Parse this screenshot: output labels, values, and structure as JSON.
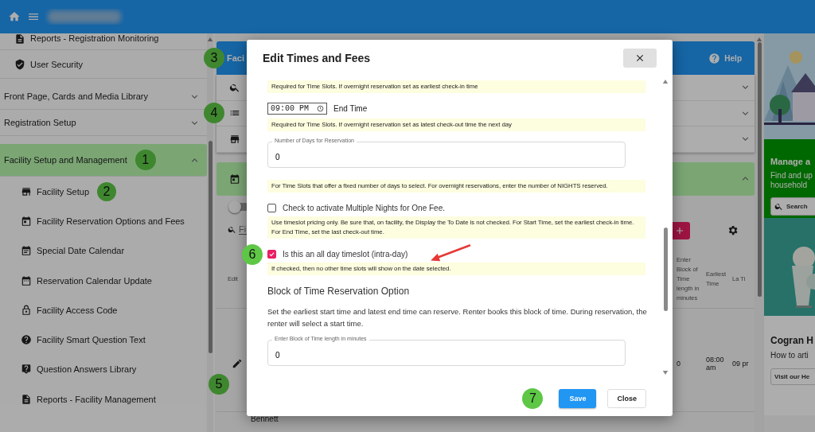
{
  "sidebar": {
    "items": [
      {
        "kind": "link",
        "label": "Reports - Registration Monitoring"
      },
      {
        "kind": "link",
        "label": "User Security"
      },
      {
        "kind": "section",
        "label": "Front Page, Cards and Media Library",
        "expanded": false
      },
      {
        "kind": "section",
        "label": "Registration Setup",
        "expanded": false
      },
      {
        "kind": "section",
        "label": "Facility Setup and Management",
        "expanded": true,
        "callout": "1",
        "children": [
          {
            "label": "Facility Setup",
            "callout": "2"
          },
          {
            "label": "Facility Reservation Options and Fees"
          },
          {
            "label": "Special Date Calendar"
          },
          {
            "label": "Reservation Calendar Update"
          },
          {
            "label": "Facility Access Code"
          },
          {
            "label": "Facility Smart Question Text"
          },
          {
            "label": "Question Answers Library"
          },
          {
            "label": "Reports - Facility Management"
          }
        ]
      }
    ]
  },
  "main": {
    "header": {
      "title": "Faci",
      "callout": "3",
      "help": "Help"
    },
    "rows": [
      {
        "expanded": false
      },
      {
        "expanded": false,
        "callout": "4"
      },
      {
        "expanded": false
      }
    ],
    "section": {
      "expanded": true
    },
    "toggle": {
      "on": false
    },
    "filter": {
      "placeholder": "Fi"
    },
    "table": {
      "columns": [
        "Edit",
        "Enter Block of Time length in minutes",
        "Earliest Time",
        "La Ti"
      ],
      "rows": [
        {
          "callout": "5",
          "cells": [
            "",
            "0",
            "08:00 am",
            "09 pr"
          ]
        }
      ],
      "next_row": "Bennett"
    }
  },
  "aside": {
    "cards": [
      {
        "title": "Manage a",
        "text": "Find and up household",
        "button": "Search"
      },
      {
        "title": "Cogran H",
        "text": "How to arti",
        "button": "Visit our He"
      }
    ]
  },
  "modal": {
    "title": "Edit Times and Fees",
    "body": [
      {
        "kind": "note",
        "text": "Required for Time Slots. If overnight reservation set as earliest check-in time"
      },
      {
        "kind": "time",
        "value": "09:00 PM",
        "label": "End Time"
      },
      {
        "kind": "note",
        "text": "Required for Time Slots. If overnight reservation set as latest check-out time the next day"
      },
      {
        "kind": "field",
        "label": "Number of Days for Reservation",
        "value": "0"
      },
      {
        "kind": "note",
        "text": "For Time Slots that offer a fixed number of days to select. For overnight reservations, enter the number of NIGHTS reserved."
      },
      {
        "kind": "checkbox",
        "label": "Check to activate Multiple Nights for One Fee.",
        "checked": false
      },
      {
        "kind": "note",
        "text": "Use timeslot pricing only. Be sure that, on facility, the Display the To Date is not checked. For Start Time, set the earliest check-in time. For End Time, set the last check-out time."
      },
      {
        "kind": "checkbox",
        "label": "Is this an all day timeslot (intra-day)",
        "checked": true,
        "callout": "6",
        "arrow": true
      },
      {
        "kind": "note",
        "text": "If checked, then no other time slots will show on the date selected."
      },
      {
        "kind": "heading",
        "text": "Block of Time Reservation Option"
      },
      {
        "kind": "paragraph",
        "text": "Set the earliest start time and latest end time can reserve. Renter books this block of time. During reservation, the renter will select a start time."
      },
      {
        "kind": "field",
        "label": "Enter Block of Time length in minutes",
        "value": "0"
      }
    ],
    "footer_callout": "7",
    "buttons": {
      "save": "Save",
      "close": "Close"
    }
  }
}
